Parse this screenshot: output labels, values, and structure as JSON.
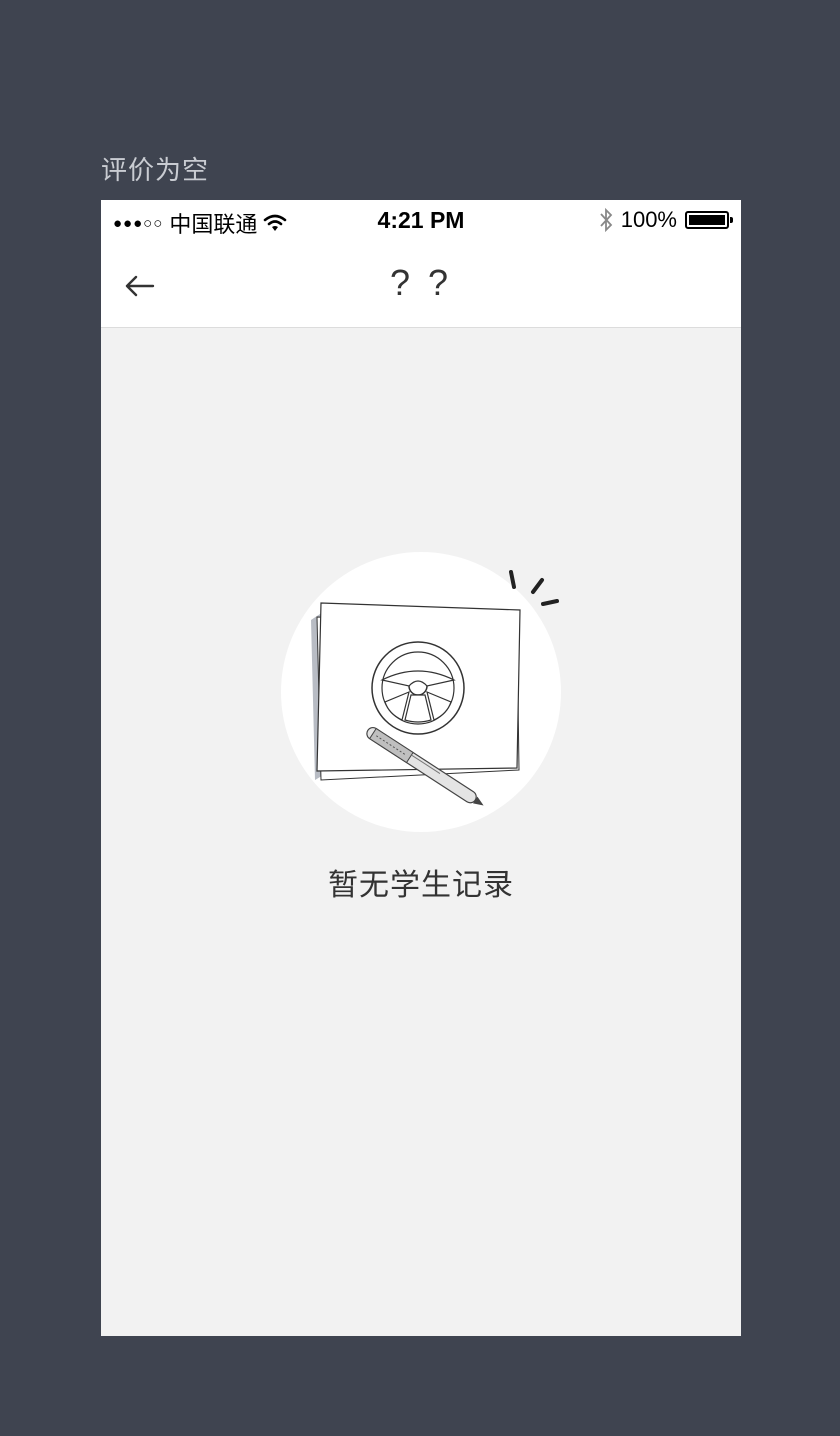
{
  "page": {
    "label": "评价为空"
  },
  "status_bar": {
    "signal": "●●●○○",
    "carrier": "中国联通",
    "time": "4:21 PM",
    "battery_text": "100%",
    "battery_level": 1.0
  },
  "nav": {
    "back_icon": "arrow-left-icon",
    "title": "? ?"
  },
  "empty_state": {
    "illustration_icon": "steering-wheel-paper-pen-icon",
    "message": "暂无学生记录"
  },
  "colors": {
    "background": "#3f4450",
    "screen": "#f2f2f2",
    "bar": "#ffffff",
    "text": "#333333"
  }
}
